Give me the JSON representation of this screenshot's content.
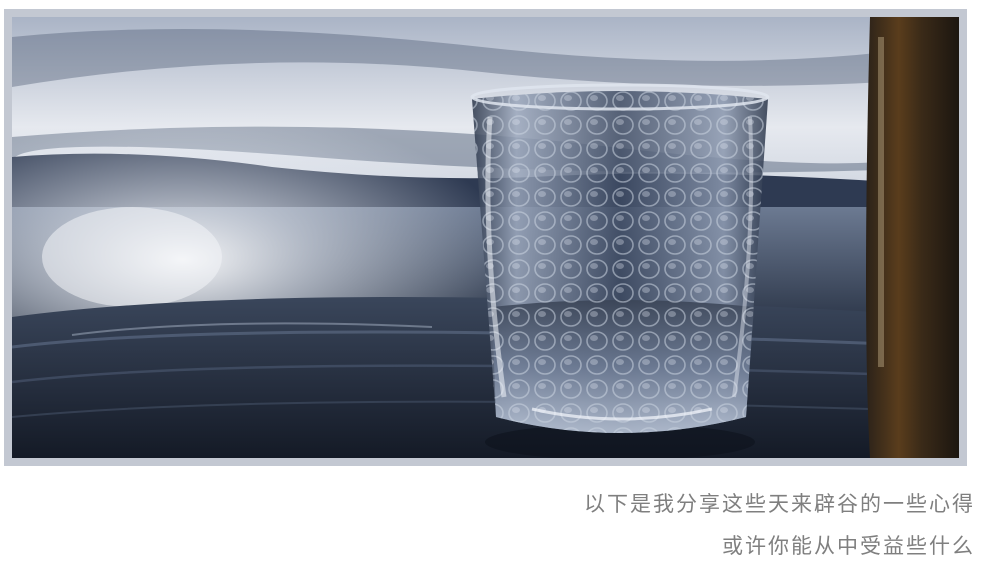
{
  "caption": {
    "line1": "以下是我分享这些天来辟谷的一些心得",
    "line2": "或许你能从中受益些什么"
  },
  "colors": {
    "frame": "#c3c8d2",
    "caption_text": "#7f7f7f",
    "sky_light": "#e9ecf1",
    "sea_dark": "#1d2638",
    "wood": "#232b3a"
  },
  "photo": {
    "subject": "textured glass of water on wooden table by the sea at dusk"
  }
}
